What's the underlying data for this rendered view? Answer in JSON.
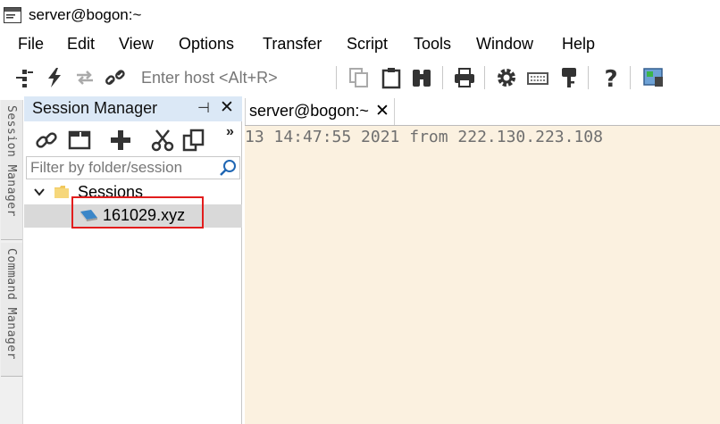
{
  "window": {
    "title": "server@bogon:~"
  },
  "menu": [
    "File",
    "Edit",
    "View",
    "Options",
    "Transfer",
    "Script",
    "Tools",
    "Window",
    "Help"
  ],
  "toolbar": {
    "host_placeholder": "Enter host <Alt+R>",
    "icons": [
      "connect-icon",
      "quick-connect-icon",
      "reconnect-icon",
      "disconnect-icon",
      "copy-icon",
      "paste-icon",
      "find-icon",
      "print-icon",
      "settings-icon",
      "keymap-icon",
      "key-icon",
      "help-icon",
      "sftp-icon"
    ]
  },
  "side_tabs": [
    "Session Manager",
    "Command Manager"
  ],
  "session_manager": {
    "title": "Session Manager",
    "pin_symbol": "⊣",
    "close_symbol": "✕",
    "more_symbol": "»",
    "filter_placeholder": "Filter by folder/session",
    "tree": {
      "folder_label": "Sessions",
      "sessions": [
        {
          "label": "161029.xyz",
          "selected": true
        }
      ]
    }
  },
  "terminal": {
    "tab_label": "server@bogon:~",
    "tab_close_symbol": "✕",
    "lines": [
      "13 14:47:55 2021 from 222.130.223.108"
    ]
  },
  "colors": {
    "panel_header": "#dbe8f6",
    "terminal_bg": "#fbf1e0",
    "highlight": "#e21d1d",
    "selected_row": "#d9d9d9"
  }
}
